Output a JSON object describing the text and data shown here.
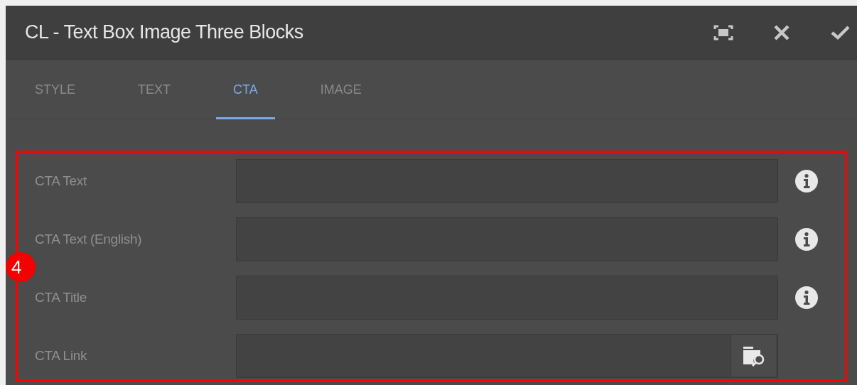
{
  "window": {
    "title": "CL - Text Box Image Three Blocks"
  },
  "tabs": [
    {
      "label": "STYLE",
      "selected": false
    },
    {
      "label": "TEXT",
      "selected": false
    },
    {
      "label": "CTA",
      "selected": true
    },
    {
      "label": "IMAGE",
      "selected": false
    }
  ],
  "annotation": {
    "number": "4"
  },
  "fields": [
    {
      "label": "CTA Text",
      "kind": "text"
    },
    {
      "label": "CTA Text (English)",
      "kind": "text"
    },
    {
      "label": "CTA Title",
      "kind": "text"
    },
    {
      "label": "CTA Link",
      "kind": "path"
    }
  ]
}
